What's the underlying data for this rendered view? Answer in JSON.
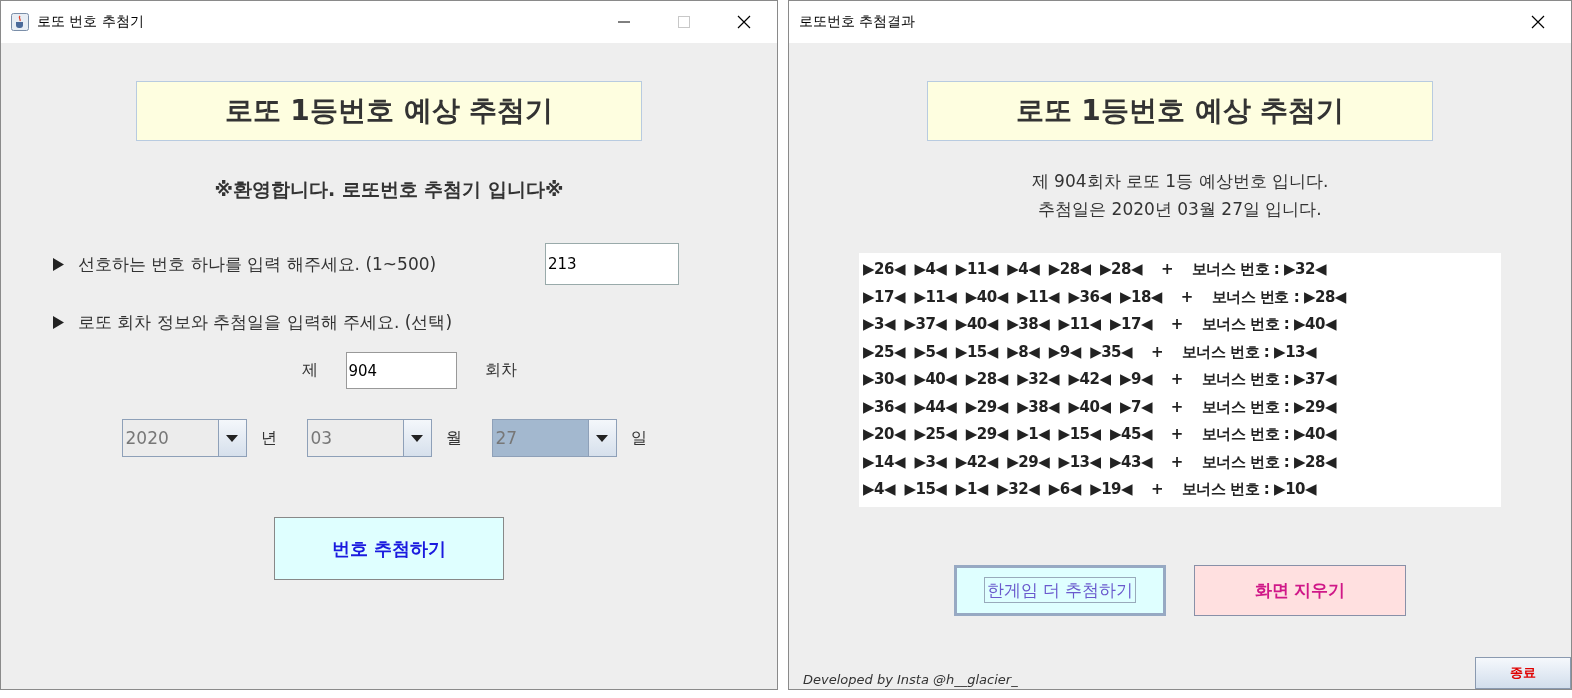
{
  "main_window": {
    "title": "로또 번호 추첨기",
    "maximize_disabled": true,
    "heading": "로또 1등번호 예상 추첨기",
    "welcome": "※환영합니다. 로또번호 추첨기 입니다※",
    "favorite_prompt": "선호하는 번호 하나를 입력 해주세요. (1~500)",
    "favorite_value": "213",
    "round_prompt": "로또 회차 정보와 추첨일을 입력해 주세요. (선택)",
    "round_prefix": "제",
    "round_value": "904",
    "round_suffix": "회차",
    "dates": [
      {
        "value": "2020",
        "unit": "년",
        "selected": false
      },
      {
        "value": "03",
        "unit": "월",
        "selected": false
      },
      {
        "value": "27",
        "unit": "일",
        "selected": true
      }
    ],
    "draw_button": "번호 추첨하기"
  },
  "result_window": {
    "title": "로또번호 추첨결과",
    "heading": "로또 1등번호 예상 추첨기",
    "info_lines": [
      "제 904회차 로또 1등 예상번호 입니다.",
      "추첨일은 2020년 03월 27일 입니다."
    ],
    "results": [
      "▶26◀  ▶4◀  ▶11◀  ▶4◀  ▶28◀  ▶28◀    +    보너스 번호 : ▶32◀",
      "▶17◀  ▶11◀  ▶40◀  ▶11◀  ▶36◀  ▶18◀    +    보너스 번호 : ▶28◀",
      "▶3◀  ▶37◀  ▶40◀  ▶38◀  ▶11◀  ▶17◀    +    보너스 번호 : ▶40◀",
      "▶25◀  ▶5◀  ▶15◀  ▶8◀  ▶9◀  ▶35◀    +    보너스 번호 : ▶13◀",
      "▶30◀  ▶40◀  ▶28◀  ▶32◀  ▶42◀  ▶9◀    +    보너스 번호 : ▶37◀",
      "▶36◀  ▶44◀  ▶29◀  ▶38◀  ▶40◀  ▶7◀    +    보너스 번호 : ▶29◀",
      "▶20◀  ▶25◀  ▶29◀  ▶1◀  ▶15◀  ▶45◀    +    보너스 번호 : ▶40◀",
      "▶14◀  ▶3◀  ▶42◀  ▶29◀  ▶13◀  ▶43◀    +    보너스 번호 : ▶28◀",
      "▶4◀  ▶15◀  ▶1◀  ▶32◀  ▶6◀  ▶19◀    +    보너스 번호 : ▶10◀"
    ],
    "buttons": [
      {
        "label": "한게임 더 추첨하기",
        "kind": "again",
        "focused": true
      },
      {
        "label": "화면 지우기",
        "kind": "clear",
        "focused": false
      }
    ],
    "credit": "Developed by Insta @h__glacier_",
    "exit_button": "종료"
  }
}
